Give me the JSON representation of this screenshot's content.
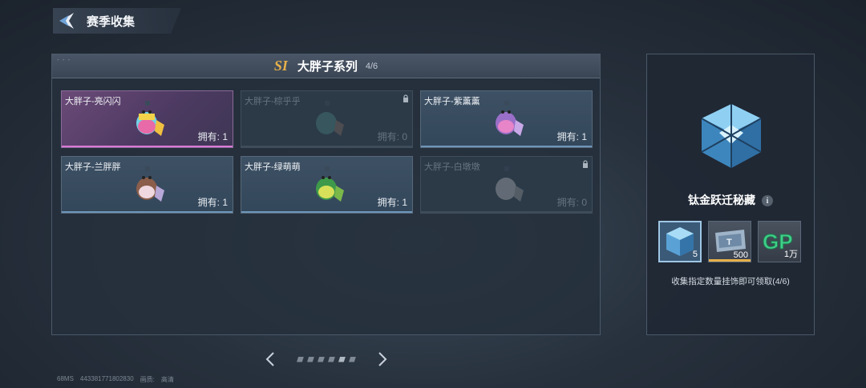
{
  "header": {
    "title": "赛季收集"
  },
  "panel": {
    "season_badge": "SI",
    "series_title": "大胖子系列",
    "series_count": "4/6"
  },
  "cards": [
    {
      "name": "大胖子-亮闪闪",
      "owned": "拥有: 1",
      "state": "selected"
    },
    {
      "name": "大胖子-棕乎乎",
      "owned": "拥有: 0",
      "state": "locked"
    },
    {
      "name": "大胖子-紫薰薰",
      "owned": "拥有: 1",
      "state": "owned"
    },
    {
      "name": "大胖子-兰胖胖",
      "owned": "拥有: 1",
      "state": "owned"
    },
    {
      "name": "大胖子-绿萌萌",
      "owned": "拥有: 1",
      "state": "owned"
    },
    {
      "name": "大胖子-白墩墩",
      "owned": "拥有: 0",
      "state": "locked"
    }
  ],
  "pager": {
    "total_pages": 6,
    "current_page": 5
  },
  "reward": {
    "name": "钛金跃迁秘藏",
    "info_icon": "i",
    "items": [
      {
        "icon": "crystal-cube-icon",
        "qty": "5"
      },
      {
        "icon": "ticket-icon",
        "qty": "500"
      },
      {
        "icon": "gp-currency-icon",
        "label": "GP",
        "qty": "1万"
      }
    ],
    "description": "收集指定数量挂饰即可领取(4/6)"
  },
  "footer": {
    "ping": "68MS",
    "uid": "443381771802830",
    "quality_label": "画质:",
    "quality_value": "高清"
  },
  "colors": {
    "accent_gold": "#e6b04a",
    "selected_pink": "#d97ad6",
    "owned_blue": "#6f96b8"
  }
}
